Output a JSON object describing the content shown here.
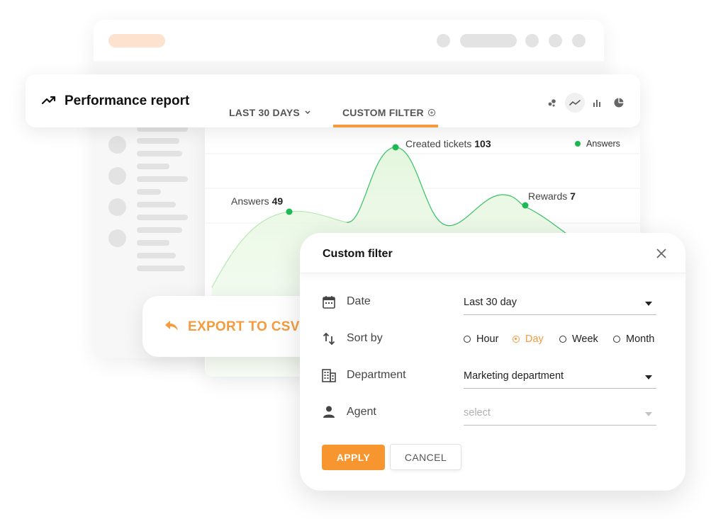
{
  "report": {
    "title": "Performance report",
    "tabs": [
      {
        "label": "LAST 30 DAYS"
      },
      {
        "label": "CUSTOM FILTER",
        "active": true
      }
    ],
    "view_icons": [
      "scatter-chart-icon",
      "line-chart-icon",
      "bar-chart-icon",
      "pie-chart-icon"
    ],
    "active_view": "line-chart-icon"
  },
  "chart_data": {
    "type": "area",
    "legend": [
      {
        "name": "Answers",
        "color": "#1db954"
      }
    ],
    "annotations": [
      {
        "label": "Answers",
        "value": "49"
      },
      {
        "label": "Created tickets",
        "value": "103"
      },
      {
        "label": "Rewards",
        "value": "7"
      }
    ],
    "grid": true,
    "color": "#1db954"
  },
  "export": {
    "label": "EXPORT TO CSV"
  },
  "filter": {
    "title": "Custom filter",
    "date_label": "Date",
    "date_value": "Last 30 day",
    "sort_label": "Sort by",
    "sort_options": [
      "Hour",
      "Day",
      "Week",
      "Month"
    ],
    "sort_selected": "Day",
    "department_label": "Department",
    "department_value": "Marketing department",
    "agent_label": "Agent",
    "agent_placeholder": "select",
    "apply_label": "APPLY",
    "cancel_label": "CANCEL"
  },
  "colors": {
    "accent": "#f59a3d",
    "chart_green": "#1db954",
    "chart_fill": "#e9f8e4"
  }
}
